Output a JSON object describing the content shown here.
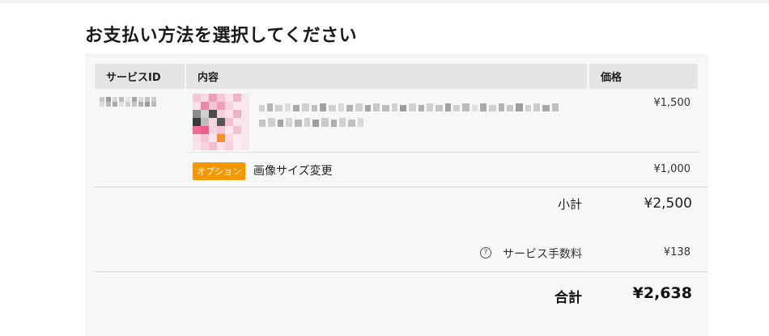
{
  "page": {
    "title": "お支払い方法を選択してください"
  },
  "table": {
    "headers": {
      "service_id": "サービスID",
      "content": "内容",
      "price": "価格"
    },
    "item": {
      "price": "¥1,500"
    },
    "option": {
      "badge": "オプション",
      "label": "画像サイズ変更",
      "price": "¥1,000"
    }
  },
  "summary": {
    "subtotal_label": "小計",
    "subtotal_value": "¥2,500",
    "fee_label": "サービス手数料",
    "fee_value": "¥138",
    "fee_icon": "question-circle-icon",
    "total_label": "合計",
    "total_value": "¥2,638"
  },
  "colors": {
    "option_badge": "#f39800",
    "header_bg": "#e3e5e7",
    "panel_bg": "#f6f7f8"
  }
}
